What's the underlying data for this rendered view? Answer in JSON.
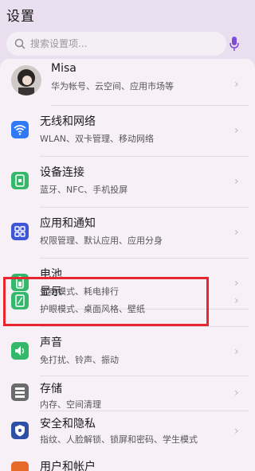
{
  "header": {
    "title": "设置"
  },
  "search": {
    "placeholder": "搜索设置项..."
  },
  "profile": {
    "name": "Misa",
    "subtitle": "华为帐号、云空间、应用市场等"
  },
  "items": [
    {
      "title": "无线和网络",
      "subtitle": "WLAN、双卡管理、移动网络",
      "icon": "wifi-icon",
      "color": "#2f7bf6"
    },
    {
      "title": "设备连接",
      "subtitle": "蓝牙、NFC、手机投屏",
      "icon": "device-connection-icon",
      "color": "#34b86b"
    },
    {
      "title": "应用和通知",
      "subtitle": "权限管理、默认应用、应用分身",
      "icon": "apps-icon",
      "color": "#3f56d6"
    },
    {
      "title": "电池",
      "subtitle": "省电模式、耗电排行",
      "icon": "battery-icon",
      "color": "#34b86b"
    },
    {
      "title": "显示",
      "subtitle": "护眼模式、桌面风格、壁纸",
      "icon": "display-icon",
      "color": "#34b86b"
    },
    {
      "title": "声音",
      "subtitle": "免打扰、铃声、振动",
      "icon": "sound-icon",
      "color": "#34b86b"
    },
    {
      "title": "存储",
      "subtitle": "内存、空间清理",
      "icon": "storage-icon",
      "color": "#6b6b6b"
    },
    {
      "title": "安全和隐私",
      "subtitle": "指纹、人脸解锁、锁屏和密码、学生模式",
      "icon": "shield-icon",
      "color": "#2d4fa5"
    },
    {
      "title": "用户和帐户",
      "subtitle": "",
      "icon": "users-icon",
      "color": "#e56a2a"
    }
  ],
  "highlight_color": "#e8262d",
  "chevron": "›"
}
